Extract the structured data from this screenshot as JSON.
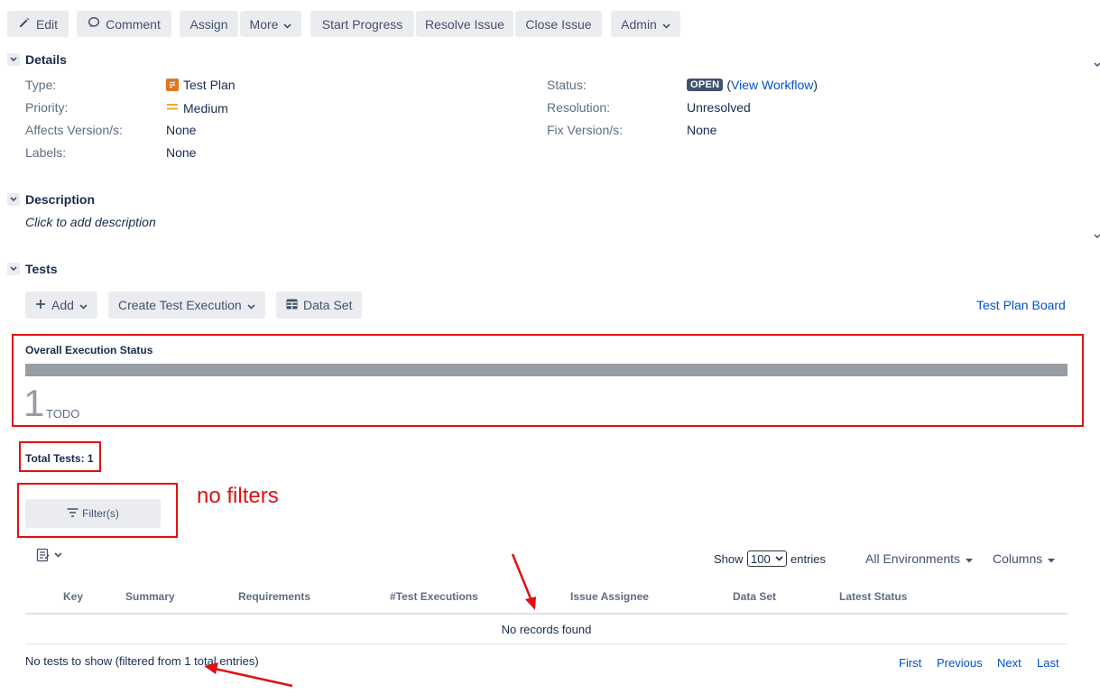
{
  "toolbar": {
    "edit": "Edit",
    "comment": "Comment",
    "assign": "Assign",
    "more": "More",
    "start_progress": "Start Progress",
    "resolve_issue": "Resolve Issue",
    "close_issue": "Close Issue",
    "admin": "Admin"
  },
  "details": {
    "title": "Details",
    "type_label": "Type:",
    "type_value": "Test Plan",
    "priority_label": "Priority:",
    "priority_value": "Medium",
    "affects_label": "Affects Version/s:",
    "affects_value": "None",
    "labels_label": "Labels:",
    "labels_value": "None",
    "status_label": "Status:",
    "status_badge": "OPEN",
    "status_link_open": "(",
    "status_link": "View Workflow",
    "status_link_close": ")",
    "resolution_label": "Resolution:",
    "resolution_value": "Unresolved",
    "fix_label": "Fix Version/s:",
    "fix_value": "None"
  },
  "description": {
    "title": "Description",
    "placeholder": "Click to add description"
  },
  "tests": {
    "title": "Tests",
    "add": "Add",
    "create_exec": "Create Test Execution",
    "data_set": "Data Set",
    "board_link": "Test Plan Board",
    "overall_title": "Overall Execution Status",
    "overall_count": "1",
    "overall_status": "TODO",
    "total_tests": "Total Tests: 1",
    "filters_btn": "Filter(s)",
    "annotation": "no filters",
    "show_label": "Show",
    "show_value": "100",
    "entries_label": "entries",
    "environments": "All Environments",
    "columns": "Columns",
    "headers": [
      "Key",
      "Summary",
      "Requirements",
      "#Test Executions",
      "Issue Assignee",
      "Data Set",
      "Latest Status"
    ],
    "empty_row": "No records found",
    "footer_info": "No tests to show (filtered from 1 total entries)",
    "pager": {
      "first": "First",
      "previous": "Previous",
      "next": "Next",
      "last": "Last"
    }
  },
  "colors": {
    "status_badge_bg": "#42526e",
    "annotation_red": "#e01010",
    "progress_todo": "#989ca3",
    "link": "#0052cc"
  }
}
